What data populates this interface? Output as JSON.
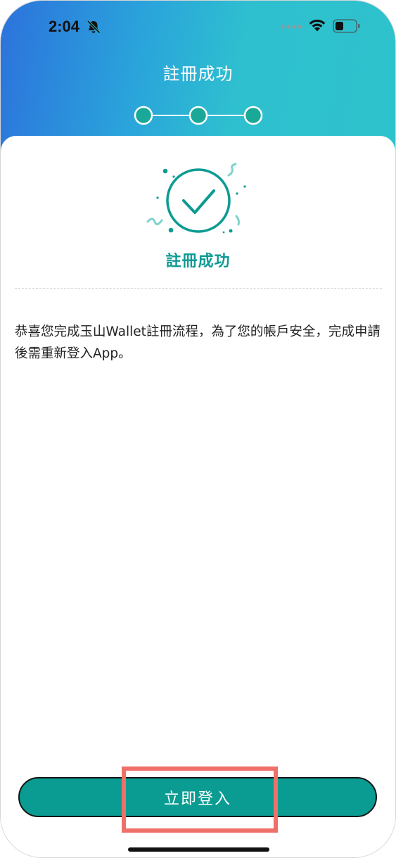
{
  "status_bar": {
    "time": "2:04",
    "icons": [
      "bell-slash-icon",
      "cellular-dots-icon",
      "wifi-icon",
      "battery-icon"
    ]
  },
  "header": {
    "title": "註冊成功",
    "steps_total": 3,
    "steps_completed": 3
  },
  "success": {
    "icon": "check-circle-icon",
    "title": "註冊成功"
  },
  "message": "恭喜您完成玉山Wallet註冊流程，為了您的帳戶安全，完成申請後需重新登入App。",
  "login_button": {
    "label": "立即登入"
  },
  "colors": {
    "accent": "#0a9c92",
    "header_gradient_start": "#2c72dc",
    "header_gradient_end": "#2ec2cc",
    "highlight": "#ef7067"
  }
}
